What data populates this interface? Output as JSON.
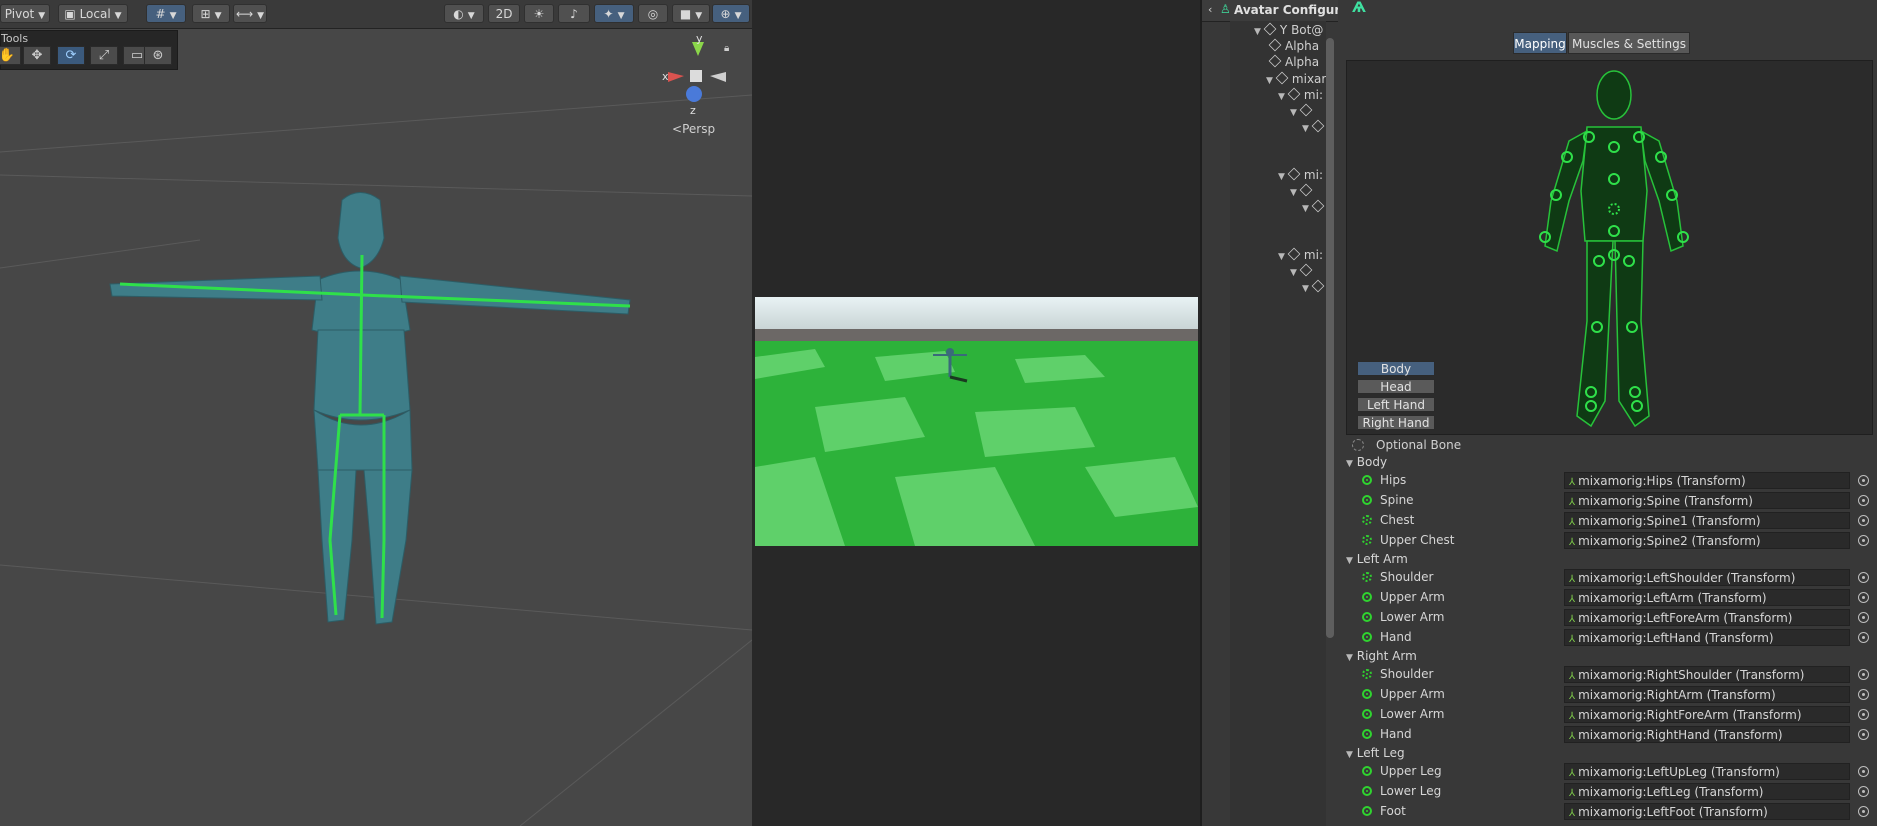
{
  "scene": {
    "toolbar": {
      "pivot_label": "Pivot",
      "local_label": "Local",
      "two_d_label": "2D"
    },
    "tools_title": "Tools",
    "gizmo": {
      "x_label": "x",
      "y_label": "y",
      "z_label": "z"
    },
    "persp_label": "Persp"
  },
  "hierarchy": {
    "title": "Avatar Configura",
    "rows": [
      {
        "label": "Y Bot@"
      },
      {
        "label": "Alpha"
      },
      {
        "label": "Alpha"
      },
      {
        "label": "mixar"
      },
      {
        "label": "mi:"
      },
      {
        "label": "mi:"
      },
      {
        "label": "mi:"
      }
    ]
  },
  "inspector": {
    "tabs": [
      "Mapping",
      "Muscles & Settings"
    ],
    "active_tab": "Mapping",
    "body_parts": [
      "Body",
      "Head",
      "Left Hand",
      "Right Hand"
    ],
    "active_part": "Body",
    "optional_label": "Optional Bone",
    "groups": [
      {
        "title": "Body",
        "bones": [
          {
            "name": "Hips",
            "value": "mixamorig:Hips (Transform)",
            "optional": false
          },
          {
            "name": "Spine",
            "value": "mixamorig:Spine (Transform)",
            "optional": false
          },
          {
            "name": "Chest",
            "value": "mixamorig:Spine1 (Transform)",
            "optional": true
          },
          {
            "name": "Upper Chest",
            "value": "mixamorig:Spine2 (Transform)",
            "optional": true
          }
        ]
      },
      {
        "title": "Left Arm",
        "bones": [
          {
            "name": "Shoulder",
            "value": "mixamorig:LeftShoulder (Transform)",
            "optional": true
          },
          {
            "name": "Upper Arm",
            "value": "mixamorig:LeftArm (Transform)",
            "optional": false
          },
          {
            "name": "Lower Arm",
            "value": "mixamorig:LeftForeArm (Transform)",
            "optional": false
          },
          {
            "name": "Hand",
            "value": "mixamorig:LeftHand (Transform)",
            "optional": false
          }
        ]
      },
      {
        "title": "Right Arm",
        "bones": [
          {
            "name": "Shoulder",
            "value": "mixamorig:RightShoulder (Transform)",
            "optional": true
          },
          {
            "name": "Upper Arm",
            "value": "mixamorig:RightArm (Transform)",
            "optional": false
          },
          {
            "name": "Lower Arm",
            "value": "mixamorig:RightForeArm (Transform)",
            "optional": false
          },
          {
            "name": "Hand",
            "value": "mixamorig:RightHand (Transform)",
            "optional": false
          }
        ]
      },
      {
        "title": "Left Leg",
        "bones": [
          {
            "name": "Upper Leg",
            "value": "mixamorig:LeftUpLeg (Transform)",
            "optional": false
          },
          {
            "name": "Lower Leg",
            "value": "mixamorig:LeftLeg (Transform)",
            "optional": false
          },
          {
            "name": "Foot",
            "value": "mixamorig:LeftFoot (Transform)",
            "optional": false
          }
        ]
      }
    ]
  },
  "colors": {
    "accent": "#46607e",
    "bone_green": "#2fd42f",
    "figure_green": "#1fae2a"
  }
}
